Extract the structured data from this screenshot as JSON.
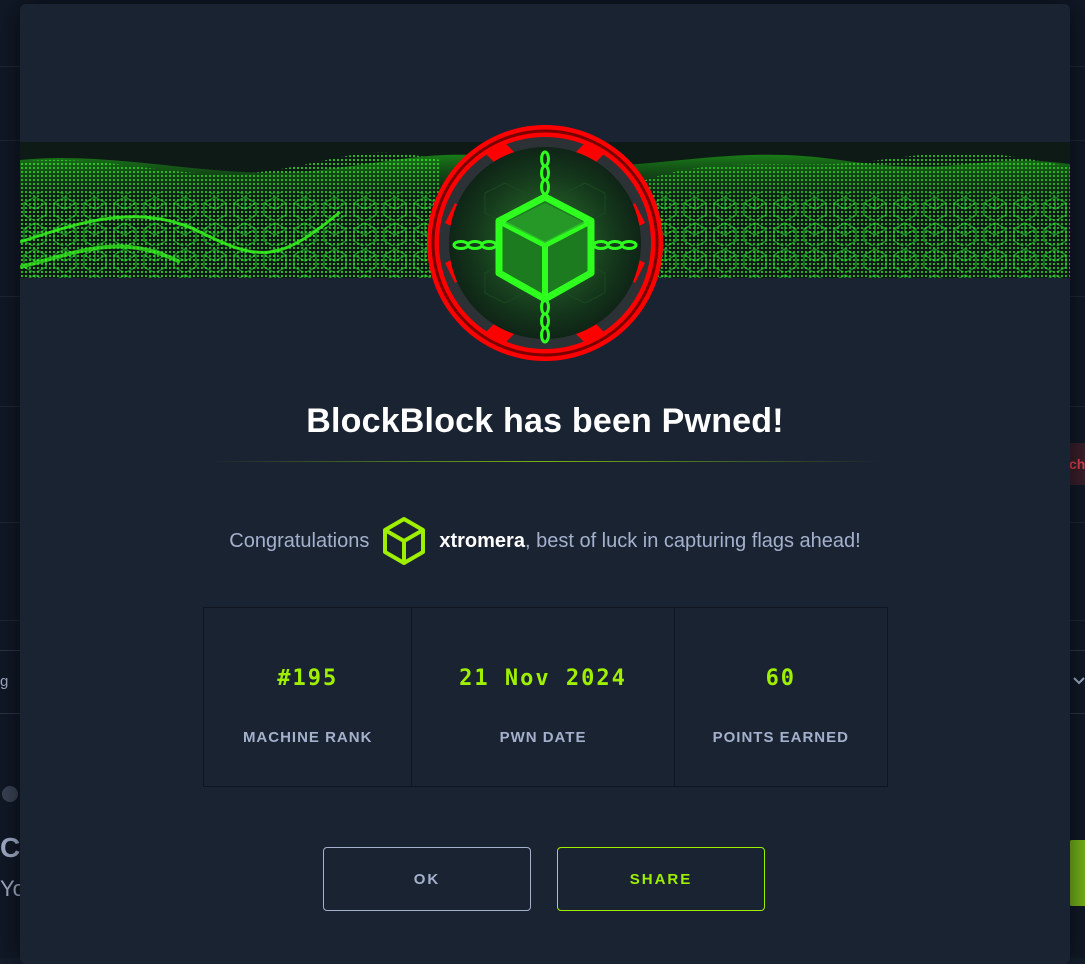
{
  "modal": {
    "title": "BlockBlock has been Pwned!",
    "congrats_prefix": "Congratulations",
    "username": "xtromera",
    "congrats_suffix": ", best of luck in capturing flags ahead!",
    "stats": [
      {
        "value": "#195",
        "label": "MACHINE RANK"
      },
      {
        "value": "21 Nov 2024",
        "label": "PWN DATE"
      },
      {
        "value": "60",
        "label": "POINTS EARNED"
      }
    ],
    "buttons": {
      "ok": "OK",
      "share": "SHARE"
    }
  },
  "background": {
    "left_text_1": "Co",
    "left_text_2": "Yo",
    "select_hint": "g",
    "red_chip": "ch"
  },
  "colors": {
    "accent": "#9fef00",
    "badge_ring": "#ff0000",
    "modal_bg": "#1a2332",
    "text_muted": "#a4b1cd"
  },
  "icons": {
    "badge": "chained-cube-icon",
    "user": "hexagon-cube-icon",
    "select": "chevron-down-icon"
  }
}
